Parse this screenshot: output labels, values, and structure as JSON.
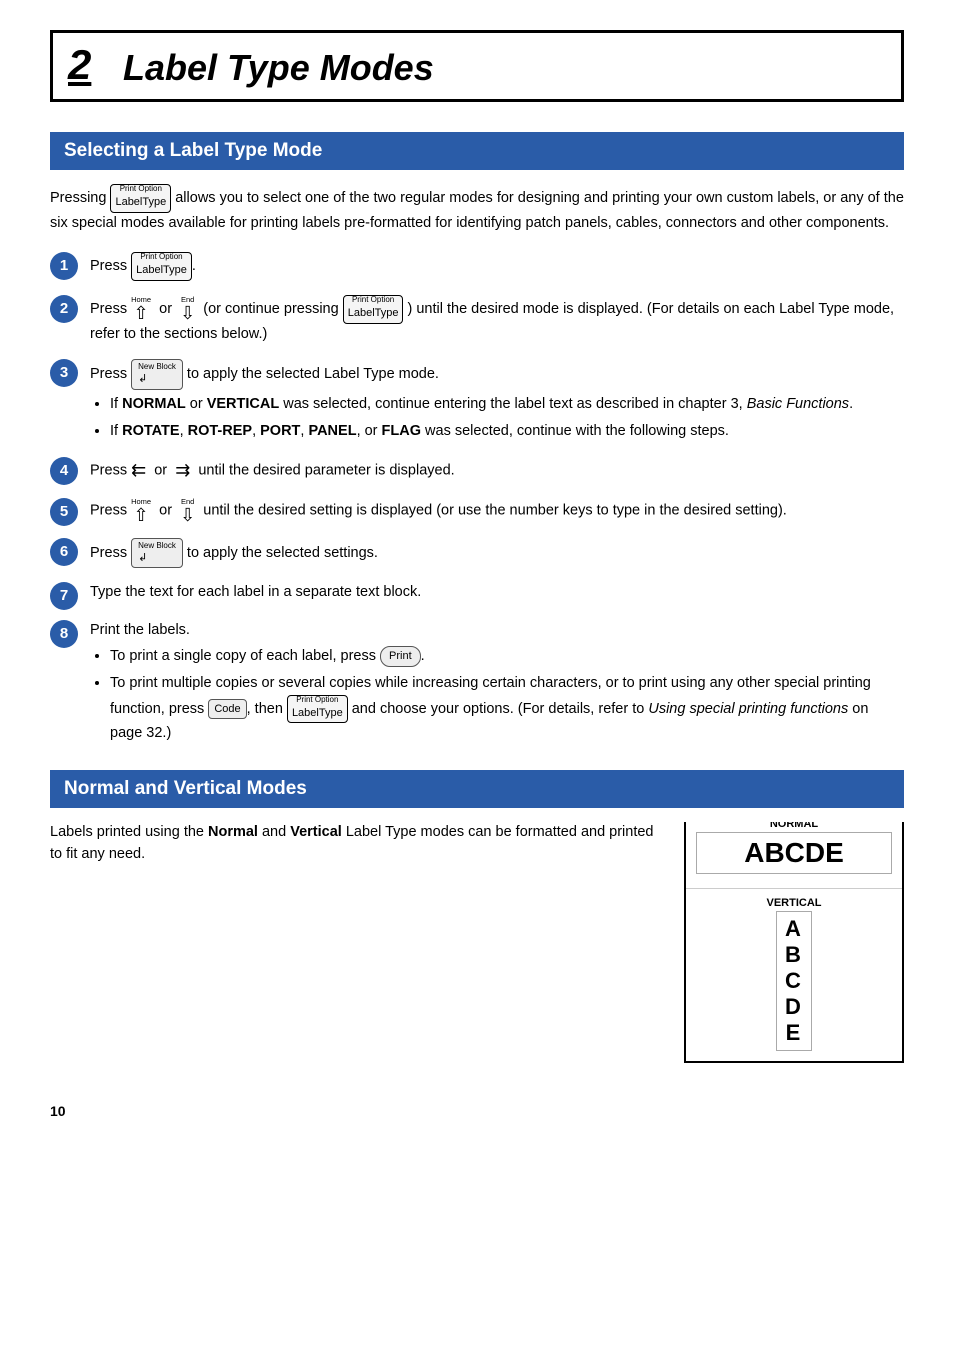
{
  "chapter": {
    "number": "2",
    "title": "Label Type Modes"
  },
  "section1": {
    "header": "Selecting a Label Type Mode",
    "intro": "Pressing  [LabelType]  allows you to select one of the two regular modes for designing and printing your own custom labels, or any of the six special modes available for printing labels pre-formatted for identifying patch panels, cables, connectors and other components.",
    "steps": [
      {
        "num": "1",
        "text": "Press [LabelType]."
      },
      {
        "num": "2",
        "text": "Press ↑ or ↓ (or continue pressing [LabelType]) until the desired mode is displayed. (For details on each Label Type mode, refer to the sections below.)"
      },
      {
        "num": "3",
        "text": "Press [Enter] to apply the selected Label Type mode.",
        "bullets": [
          "If NORMAL or VERTICAL was selected, continue entering the label text as described in chapter 3, Basic Functions.",
          "If ROTATE, ROT-REP, PORT, PANEL, or FLAG was selected, continue with the following steps."
        ]
      },
      {
        "num": "4",
        "text": "Press ← or → until the desired parameter is displayed."
      },
      {
        "num": "5",
        "text": "Press ↑ or ↓ until the desired setting is displayed (or use the number keys to type in the desired setting)."
      },
      {
        "num": "6",
        "text": "Press [Enter] to apply the selected settings."
      },
      {
        "num": "7",
        "text": "Type the text for each label in a separate text block."
      },
      {
        "num": "8",
        "text": "Print the labels.",
        "bullets": [
          "To print a single copy of each label, press [Print].",
          "To print multiple copies or several copies while increasing certain characters, or to print using any other special printing function, press [Code], then [LabelType] and choose your options. (For details, refer to Using special printing functions on page 32.)"
        ]
      }
    ]
  },
  "section2": {
    "header": "Normal and Vertical Modes",
    "intro": "Labels printed using the Normal and Vertical Label Type modes can be formatted and printed to fit any need.",
    "diagram": {
      "normal_label": "NORMAL",
      "normal_text": "ABCDE",
      "vertical_label": "VERTICAL",
      "vertical_text": "ABCDE"
    }
  },
  "page_number": "10",
  "keys": {
    "label_type_top": "Print Option",
    "label_type_main": "LabelType",
    "home_label": "Home",
    "end_label": "End",
    "new_block_label": "New Block",
    "print_label": "Print",
    "code_label": "Code"
  }
}
